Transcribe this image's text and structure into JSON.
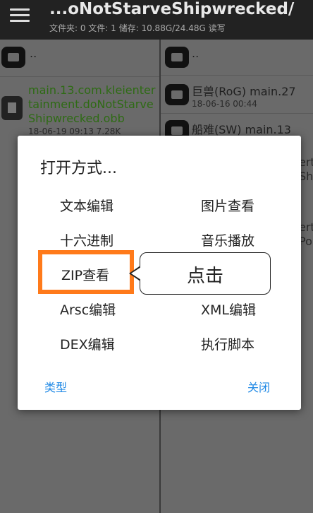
{
  "appbar": {
    "path_title": "...oNotStarveShipwrecked/",
    "path_info": "文件夹: 0  文件: 1  储存: 10.88G/24.48G  读写"
  },
  "left_pane": {
    "parent_label": "..",
    "file": {
      "name_line1": "main.13.com.kleienter",
      "name_line2": "tainment.doNotStarve",
      "name_line3": "Shipwrecked.obb",
      "meta": "18-06-19 09:13  7.28K"
    }
  },
  "right_pane": {
    "parent_label": "..",
    "items": [
      {
        "name": "巨兽(RoG) main.27",
        "meta": "18-06-16 00:44"
      },
      {
        "name": "船难(SW) main.13",
        "meta": ""
      }
    ],
    "partial_texts": [
      "ert",
      "Sh",
      "ert",
      "Po"
    ]
  },
  "dialog": {
    "title": "打开方式...",
    "options_left": [
      "文本编辑",
      "十六进制",
      "ZIP查看",
      "Arsc编辑",
      "DEX编辑"
    ],
    "options_right": [
      "图片查看",
      "音乐播放",
      "",
      "XML编辑",
      "执行脚本"
    ],
    "type_button": "类型",
    "close_button": "关闭"
  },
  "annotation": {
    "callout_text": "点击",
    "highlight_color": "#ff7a1a"
  },
  "colors": {
    "accent": "#1e88e5",
    "file_name_green": "#2e6b14"
  }
}
